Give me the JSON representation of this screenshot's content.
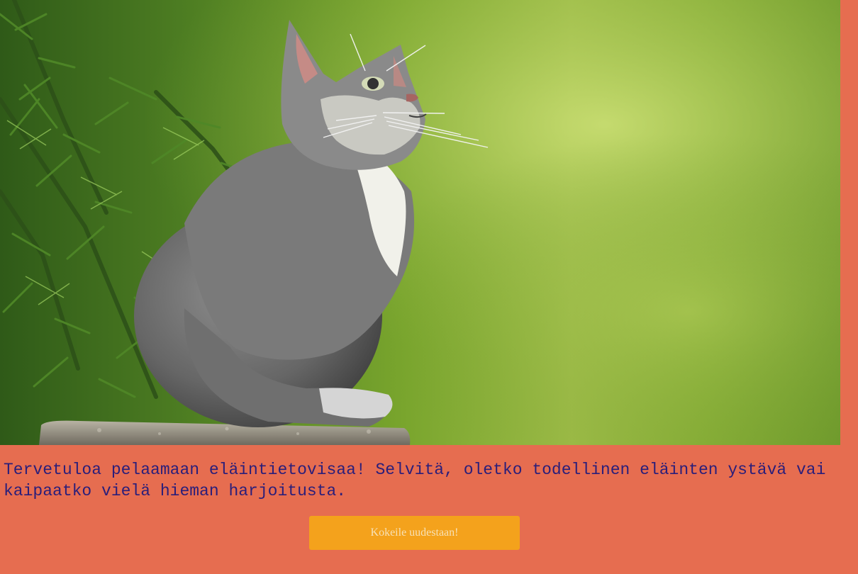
{
  "hero": {
    "image": "kitten-on-stone-photo"
  },
  "intro": {
    "text": "Tervetuloa pelaamaan eläintietovisaa! Selvitä, oletko todellinen eläinten ystävä vai kaipaatko vielä hieman harjoitusta."
  },
  "actions": {
    "retry_label": "Kokeile uudestaan!"
  },
  "colors": {
    "background": "#e66d50",
    "button": "#f4a21c",
    "button_text": "#f7e1b6",
    "text": "#2a1e7a"
  }
}
